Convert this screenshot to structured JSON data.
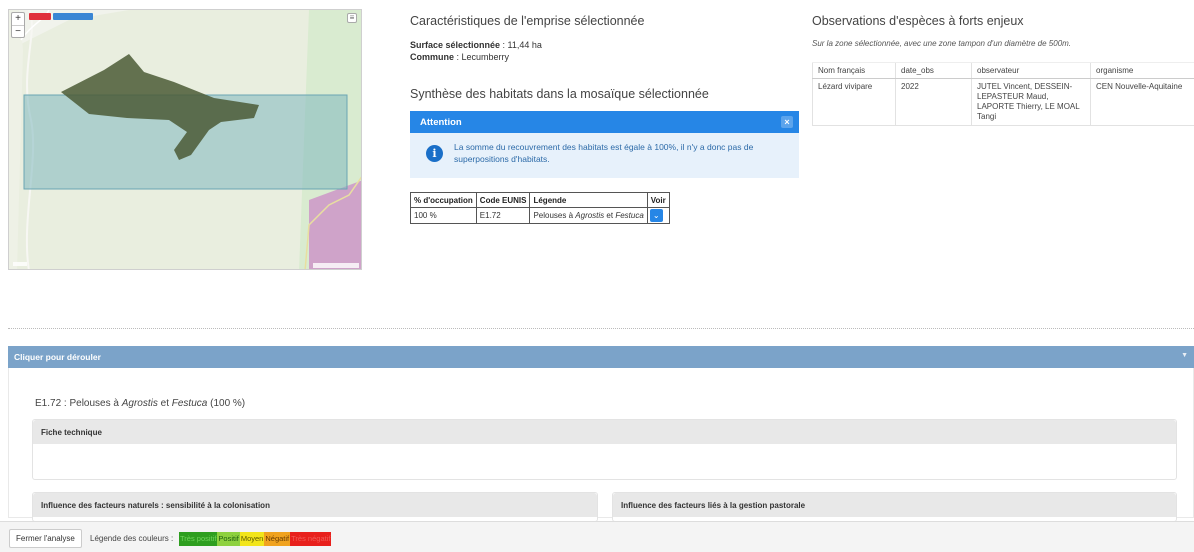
{
  "map": {
    "zoom_in": "+",
    "zoom_out": "−",
    "layers_icon": "layers-icon"
  },
  "selection": {
    "title": "Caractéristiques de l'emprise sélectionnée",
    "surface_label": "Surface sélectionnée",
    "surface_value": " : 11,44 ha",
    "commune_label": "Commune",
    "commune_value": " : Lecumberry"
  },
  "habitats": {
    "title": "Synthèse des habitats dans la mosaïque sélectionnée",
    "alert_title": "Attention",
    "alert_close": "×",
    "alert_text": "La somme du recouvrement des habitats est égale à 100%, il n'y a donc pas de superpositions d'habitats.",
    "table": {
      "headers": [
        "% d'occupation",
        "Code EUNIS",
        "Légende",
        "Voir"
      ],
      "row": {
        "occupation": "100 %",
        "code": "E1.72",
        "legend_pre": "Pelouses à ",
        "legend_i1": "Agrostis",
        "legend_mid": " et ",
        "legend_i2": "Festuca",
        "voir": "⌄"
      }
    }
  },
  "observations": {
    "title": "Observations d'espèces à forts enjeux",
    "subtitle": "Sur la zone sélectionnée, avec une zone tampon d'un diamètre de 500m.",
    "headers": [
      "Nom français",
      "date_obs",
      "observateur",
      "organisme"
    ],
    "rows": [
      {
        "nom": "Lézard vivipare",
        "date": "2022",
        "observateur": "JUTEL Vincent, DESSEIN-LEPASTEUR Maud, LAPORTE Thierry, LE MOAL Tangi",
        "organisme": "CEN Nouvelle-Aquitaine"
      }
    ]
  },
  "accordion": {
    "header": "Cliquer pour dérouler",
    "caret": "▼",
    "habitat_code": "E1.72 : Pelouses à ",
    "habitat_i1": "Agrostis",
    "habitat_mid": " et ",
    "habitat_i2": "Festuca",
    "habitat_pct": " (100 %)",
    "fiche_title": "Fiche technique",
    "natural_title": "Influence des facteurs naturels : sensibilité à la colonisation",
    "pastoral_title": "Influence des facteurs liés à la gestion pastorale"
  },
  "footer": {
    "close_button": "Fermer l'analyse",
    "legend_label": "Légende des couleurs :",
    "legend": [
      {
        "label": "Très positif",
        "bg": "#2e9e1f",
        "fg": "#6fd35a"
      },
      {
        "label": "Positif",
        "bg": "#8ed13f",
        "fg": "#1d5c0f"
      },
      {
        "label": "Moyen",
        "bg": "#f2e51a",
        "fg": "#5e5a00"
      },
      {
        "label": "Négatif",
        "bg": "#f0a21e",
        "fg": "#6a3c00"
      },
      {
        "label": "Très négatif",
        "bg": "#e8201c",
        "fg": "#f25a55"
      }
    ]
  }
}
